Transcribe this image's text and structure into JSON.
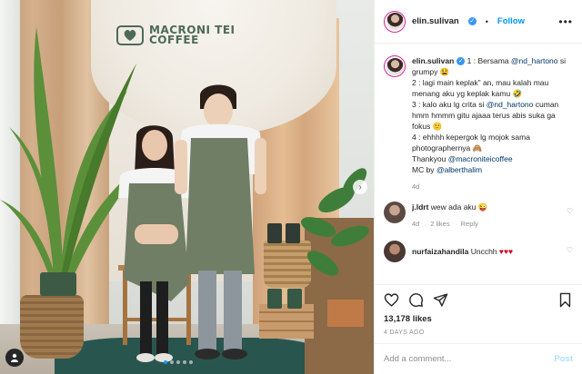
{
  "photo": {
    "logo_line1": "MACRONI TEI",
    "logo_line2": "COFFEE",
    "carousel_dots": 5,
    "carousel_active": 0
  },
  "header": {
    "username": "elin.sulivan",
    "separator": "•",
    "follow_label": "Follow",
    "more": "•••"
  },
  "caption": {
    "username": "elin.sulivan",
    "line1_prefix": "1 : Bersama",
    "mention1": "@nd_hartono",
    "line1_suffix": "si grumpy 😫",
    "line2": "2 : lagi main keplak” an, mau kalah mau menang aku yg keplak kamu 🤣",
    "line3_prefix": "3 : kalo aku lg crita si",
    "mention2": "@nd_hartono",
    "line3_suffix": "cuman hmm hmmm gitu ajaaa terus abis suka ga fokus 🙂",
    "line4": "4 : ehhhh kepergok lg mojok sama photographernya 🙈",
    "line5_prefix": "Thankyou",
    "mention3": "@macroniteicoffee",
    "line6_prefix": "MC by",
    "mention4": "@alberthalim",
    "time": "4d"
  },
  "comments": [
    {
      "username": "j.ldrt",
      "text": "wew ada aku 😜",
      "time": "4d",
      "likes": "2 likes",
      "reply": "Reply"
    },
    {
      "username": "nurfaizahandila",
      "text": "Uncchh",
      "hearts": "♥♥♥"
    }
  ],
  "post_info": {
    "likes": "13,178 likes",
    "ago": "4 DAYS AGO"
  },
  "add_comment": {
    "placeholder": "Add a comment...",
    "post_label": "Post"
  },
  "colors": {
    "accent": "#0095f6",
    "verified": "#3897f0",
    "apron": "#6f7e65",
    "rug": "#29554f"
  }
}
